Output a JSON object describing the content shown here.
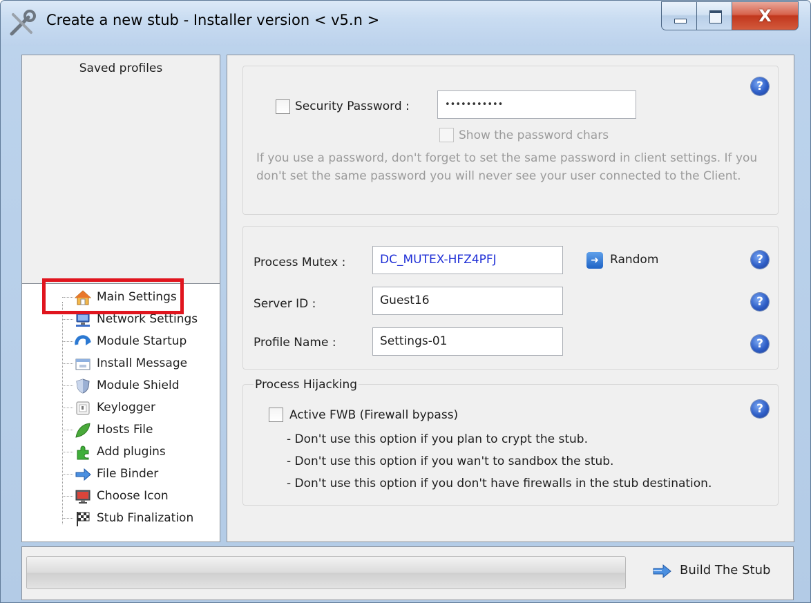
{
  "window": {
    "title": "Create a new stub - Installer version < v5.n >",
    "close_glyph": "X"
  },
  "left": {
    "profiles_header": "Saved profiles",
    "tree_items": [
      {
        "label": "Main Settings",
        "icon": "home-icon",
        "selected": true
      },
      {
        "label": "Network Settings",
        "icon": "network-icon"
      },
      {
        "label": "Module Startup",
        "icon": "startup-icon"
      },
      {
        "label": "Install Message",
        "icon": "message-icon"
      },
      {
        "label": "Module Shield",
        "icon": "shield-icon"
      },
      {
        "label": "Keylogger",
        "icon": "keylogger-icon"
      },
      {
        "label": "Hosts File",
        "icon": "leaf-icon"
      },
      {
        "label": "Add plugins",
        "icon": "puzzle-icon"
      },
      {
        "label": "File Binder",
        "icon": "binder-arrow-icon"
      },
      {
        "label": "Choose Icon",
        "icon": "monitor-icon"
      },
      {
        "label": "Stub Finalization",
        "icon": "finish-flag-icon"
      }
    ]
  },
  "security": {
    "password_label": "Security Password :",
    "password_value": "•••••••••••",
    "show_chars_label": "Show the password chars",
    "hint": "If you use a password, don't forget to set the same password in client settings. If you don't set the same password you will never see your user connected to the Client."
  },
  "identity": {
    "mutex_label": "Process Mutex :",
    "mutex_value": "DC_MUTEX-HFZ4PFJ",
    "random_label": "Random",
    "server_id_label": "Server ID :",
    "server_id_value": "Guest16",
    "profile_name_label": "Profile Name :",
    "profile_name_value": "Settings-01"
  },
  "hijacking": {
    "legend": "Process Hijacking",
    "fwb_label": "Active FWB (Firewall bypass)",
    "notes": [
      "- Don't use this option if you plan to crypt the stub.",
      "- Don't use this option if you wan't to sandbox the stub.",
      "- Don't use this option if you don't have firewalls in the stub destination."
    ]
  },
  "help_glyph": "?",
  "bottom": {
    "build_label": "Build The Stub"
  },
  "colors": {
    "mutex_text": "#1f2fd6",
    "highlight": "#e0151e"
  }
}
